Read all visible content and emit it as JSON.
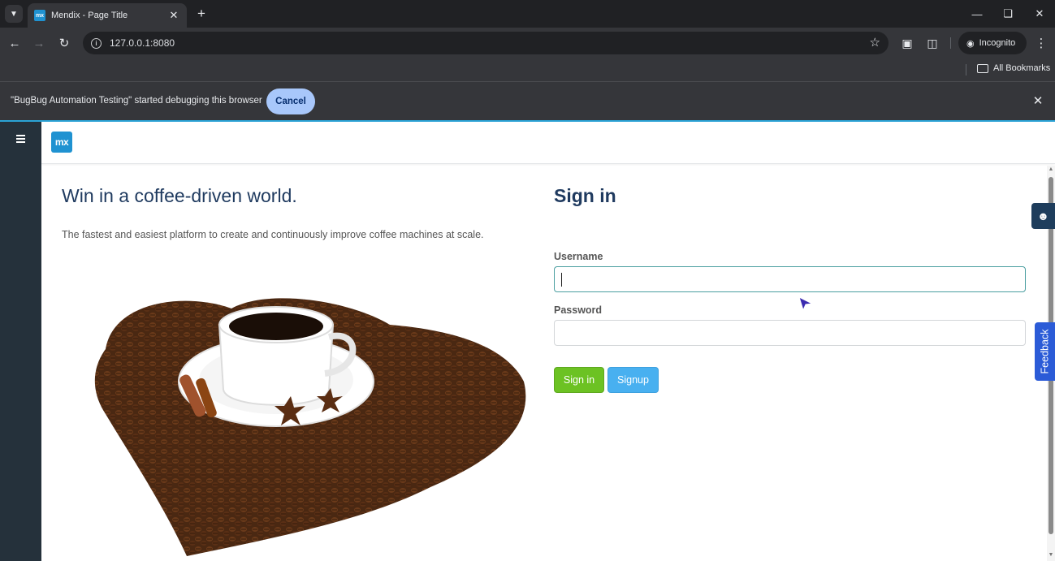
{
  "browser": {
    "tab_title": "Mendix - Page Title",
    "favicon_text": "mx",
    "url": "127.0.0.1:8080",
    "incognito_label": "Incognito",
    "bookmarks_label": "All Bookmarks"
  },
  "debug_bar": {
    "message": "\"BugBug Automation Testing\" started debugging this browser",
    "cancel_label": "Cancel"
  },
  "app": {
    "logo_text": "mx",
    "hero_title": "Win in a coffee-driven world.",
    "hero_subtitle": "The fastest and easiest platform to create and continuously improve coffee machines at scale."
  },
  "signin": {
    "title": "Sign in",
    "username_label": "Username",
    "username_value": "",
    "password_label": "Password",
    "password_value": "",
    "signin_button": "Sign in",
    "signup_button": "Signup"
  },
  "feedback": {
    "label": "Feedback"
  },
  "colors": {
    "brand_blue": "#1f92d1",
    "title_navy": "#1f3a5f",
    "signin_green": "#6cc223",
    "signup_blue": "#48b0f0",
    "feedback_blue": "#2b5bd7",
    "sidebar_dark": "#25313b"
  }
}
